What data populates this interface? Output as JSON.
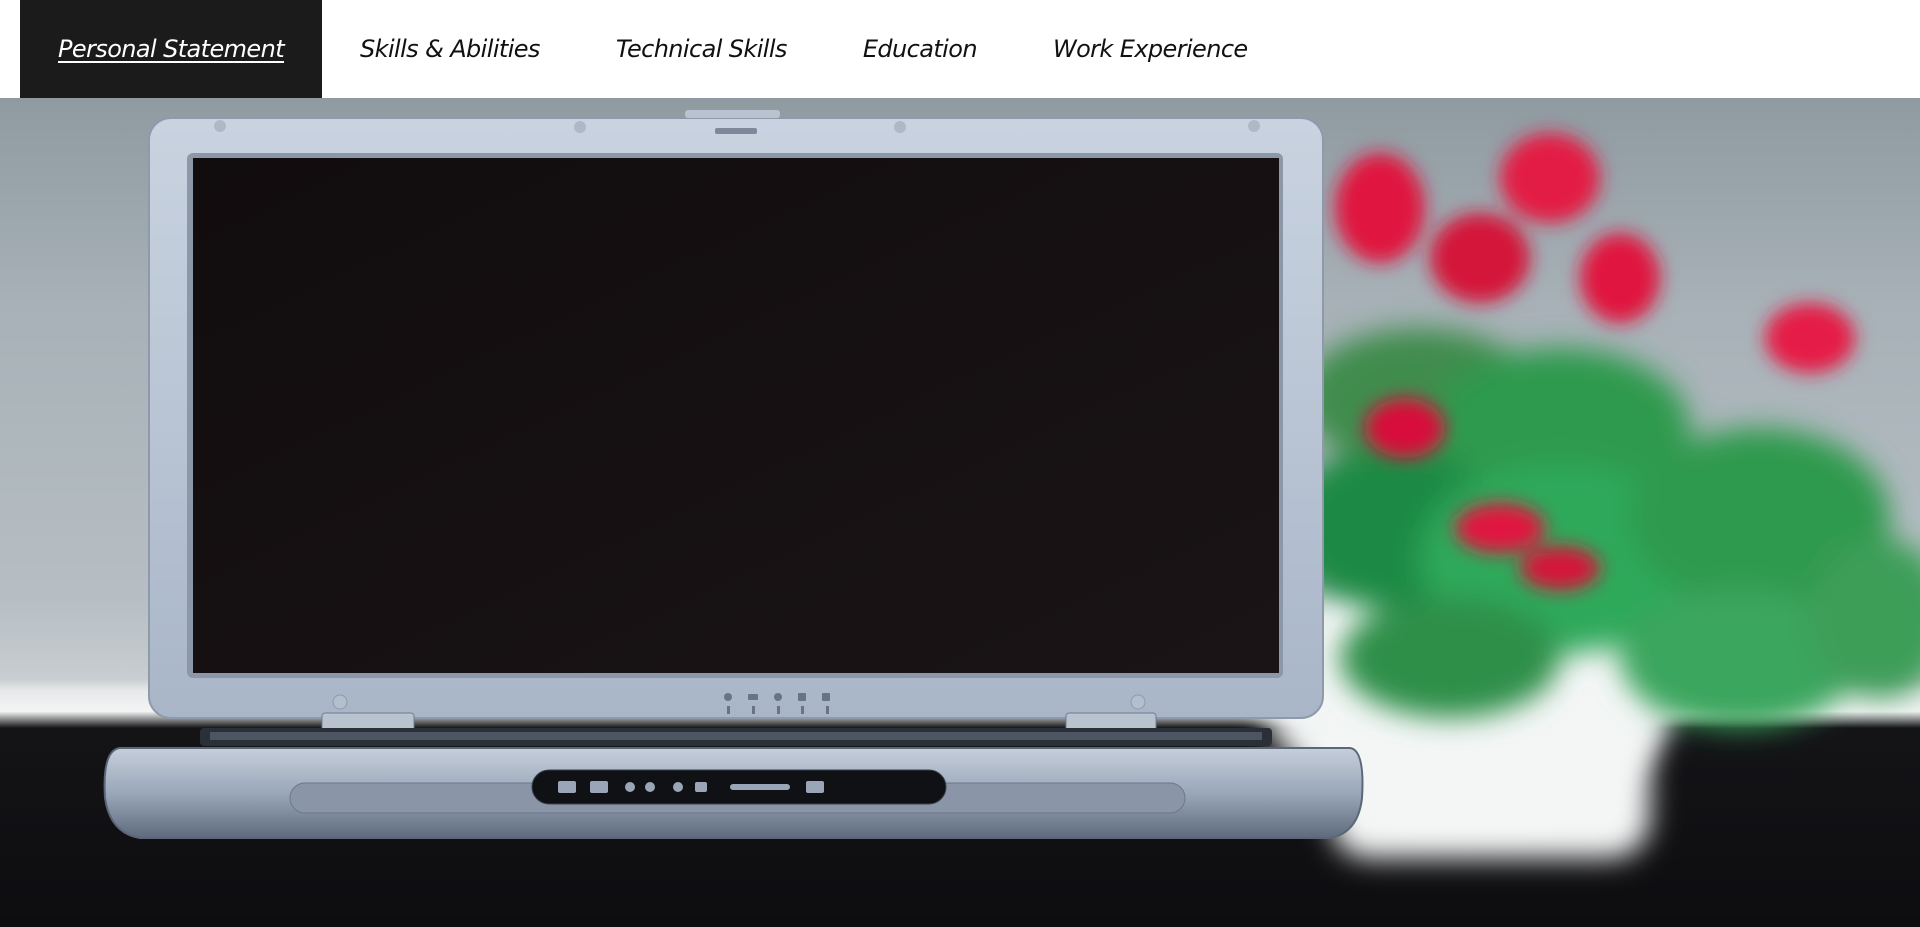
{
  "nav": {
    "items": [
      {
        "label": "Personal Statement",
        "active": true
      },
      {
        "label": "Skills & Abilities",
        "active": false
      },
      {
        "label": "Technical Skills",
        "active": false
      },
      {
        "label": "Education",
        "active": false
      },
      {
        "label": "Work Experience",
        "active": false
      }
    ],
    "active_bg": "#1b1b1b",
    "active_text": "#ffffff",
    "text": "#111111"
  },
  "hero": {
    "subject": "laptop-with-flowering-plant",
    "accent_flower": "#e0163f",
    "accent_leaf": "#2f9a4d"
  }
}
